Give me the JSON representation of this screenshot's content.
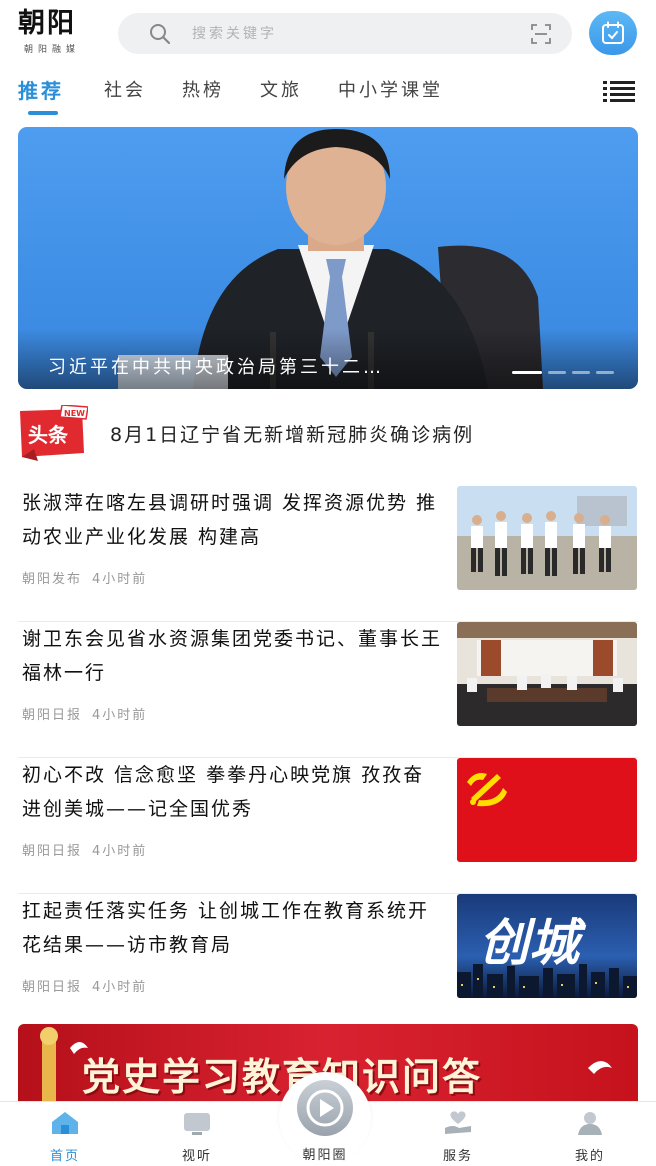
{
  "header": {
    "logo_title": "朝阳",
    "logo_subtitle": "朝阳融媒",
    "search_placeholder": "搜索关键字"
  },
  "tabs": [
    {
      "label": "推荐",
      "active": true
    },
    {
      "label": "社会",
      "active": false
    },
    {
      "label": "热榜",
      "active": false
    },
    {
      "label": "文旅",
      "active": false
    },
    {
      "label": "中小学课堂",
      "active": false
    }
  ],
  "banner": {
    "caption": "习近平在中共中央政治局第三十二…",
    "nameplate": "XI JINPING",
    "slide_count": 4,
    "active_slide": 1
  },
  "headline": {
    "badge": "头条",
    "badge_tag": "NEW",
    "text": "8月1日辽宁省无新增新冠肺炎确诊病例"
  },
  "news": [
    {
      "title": "张淑萍在喀左县调研时强调 发挥资源优势 推动农业产业化发展 构建高",
      "source": "朝阳发布",
      "time": "4小时前",
      "thumb": "people-outdoor"
    },
    {
      "title": "谢卫东会见省水资源集团党委书记、董事长王福林一行",
      "source": "朝阳日报",
      "time": "4小时前",
      "thumb": "meeting-room"
    },
    {
      "title": "初心不改  信念愈坚  拳拳丹心映党旗  孜孜奋进创美城——记全国优秀",
      "source": "朝阳日报",
      "time": "4小时前",
      "thumb": "party-flag"
    },
    {
      "title": "扛起责任落实任务  让创城工作在教育系统开花结果——访市教育局",
      "source": "朝阳日报",
      "time": "4小时前",
      "thumb": "chuangcheng",
      "thumb_text": "创城"
    }
  ],
  "promo": {
    "text": "党史学习教育知识问答"
  },
  "bottom_nav": [
    {
      "label": "首页",
      "icon": "home-icon",
      "active": true
    },
    {
      "label": "视听",
      "icon": "tv-icon",
      "active": false
    },
    {
      "label": "朝阳圈",
      "icon": "play-circle-icon",
      "active": false
    },
    {
      "label": "服务",
      "icon": "heart-hand-icon",
      "active": false
    },
    {
      "label": "我的",
      "icon": "user-icon",
      "active": false
    }
  ],
  "colors": {
    "accent": "#2a8fd8",
    "headline_red": "#e12a2f",
    "promo_red": "#d92231"
  }
}
